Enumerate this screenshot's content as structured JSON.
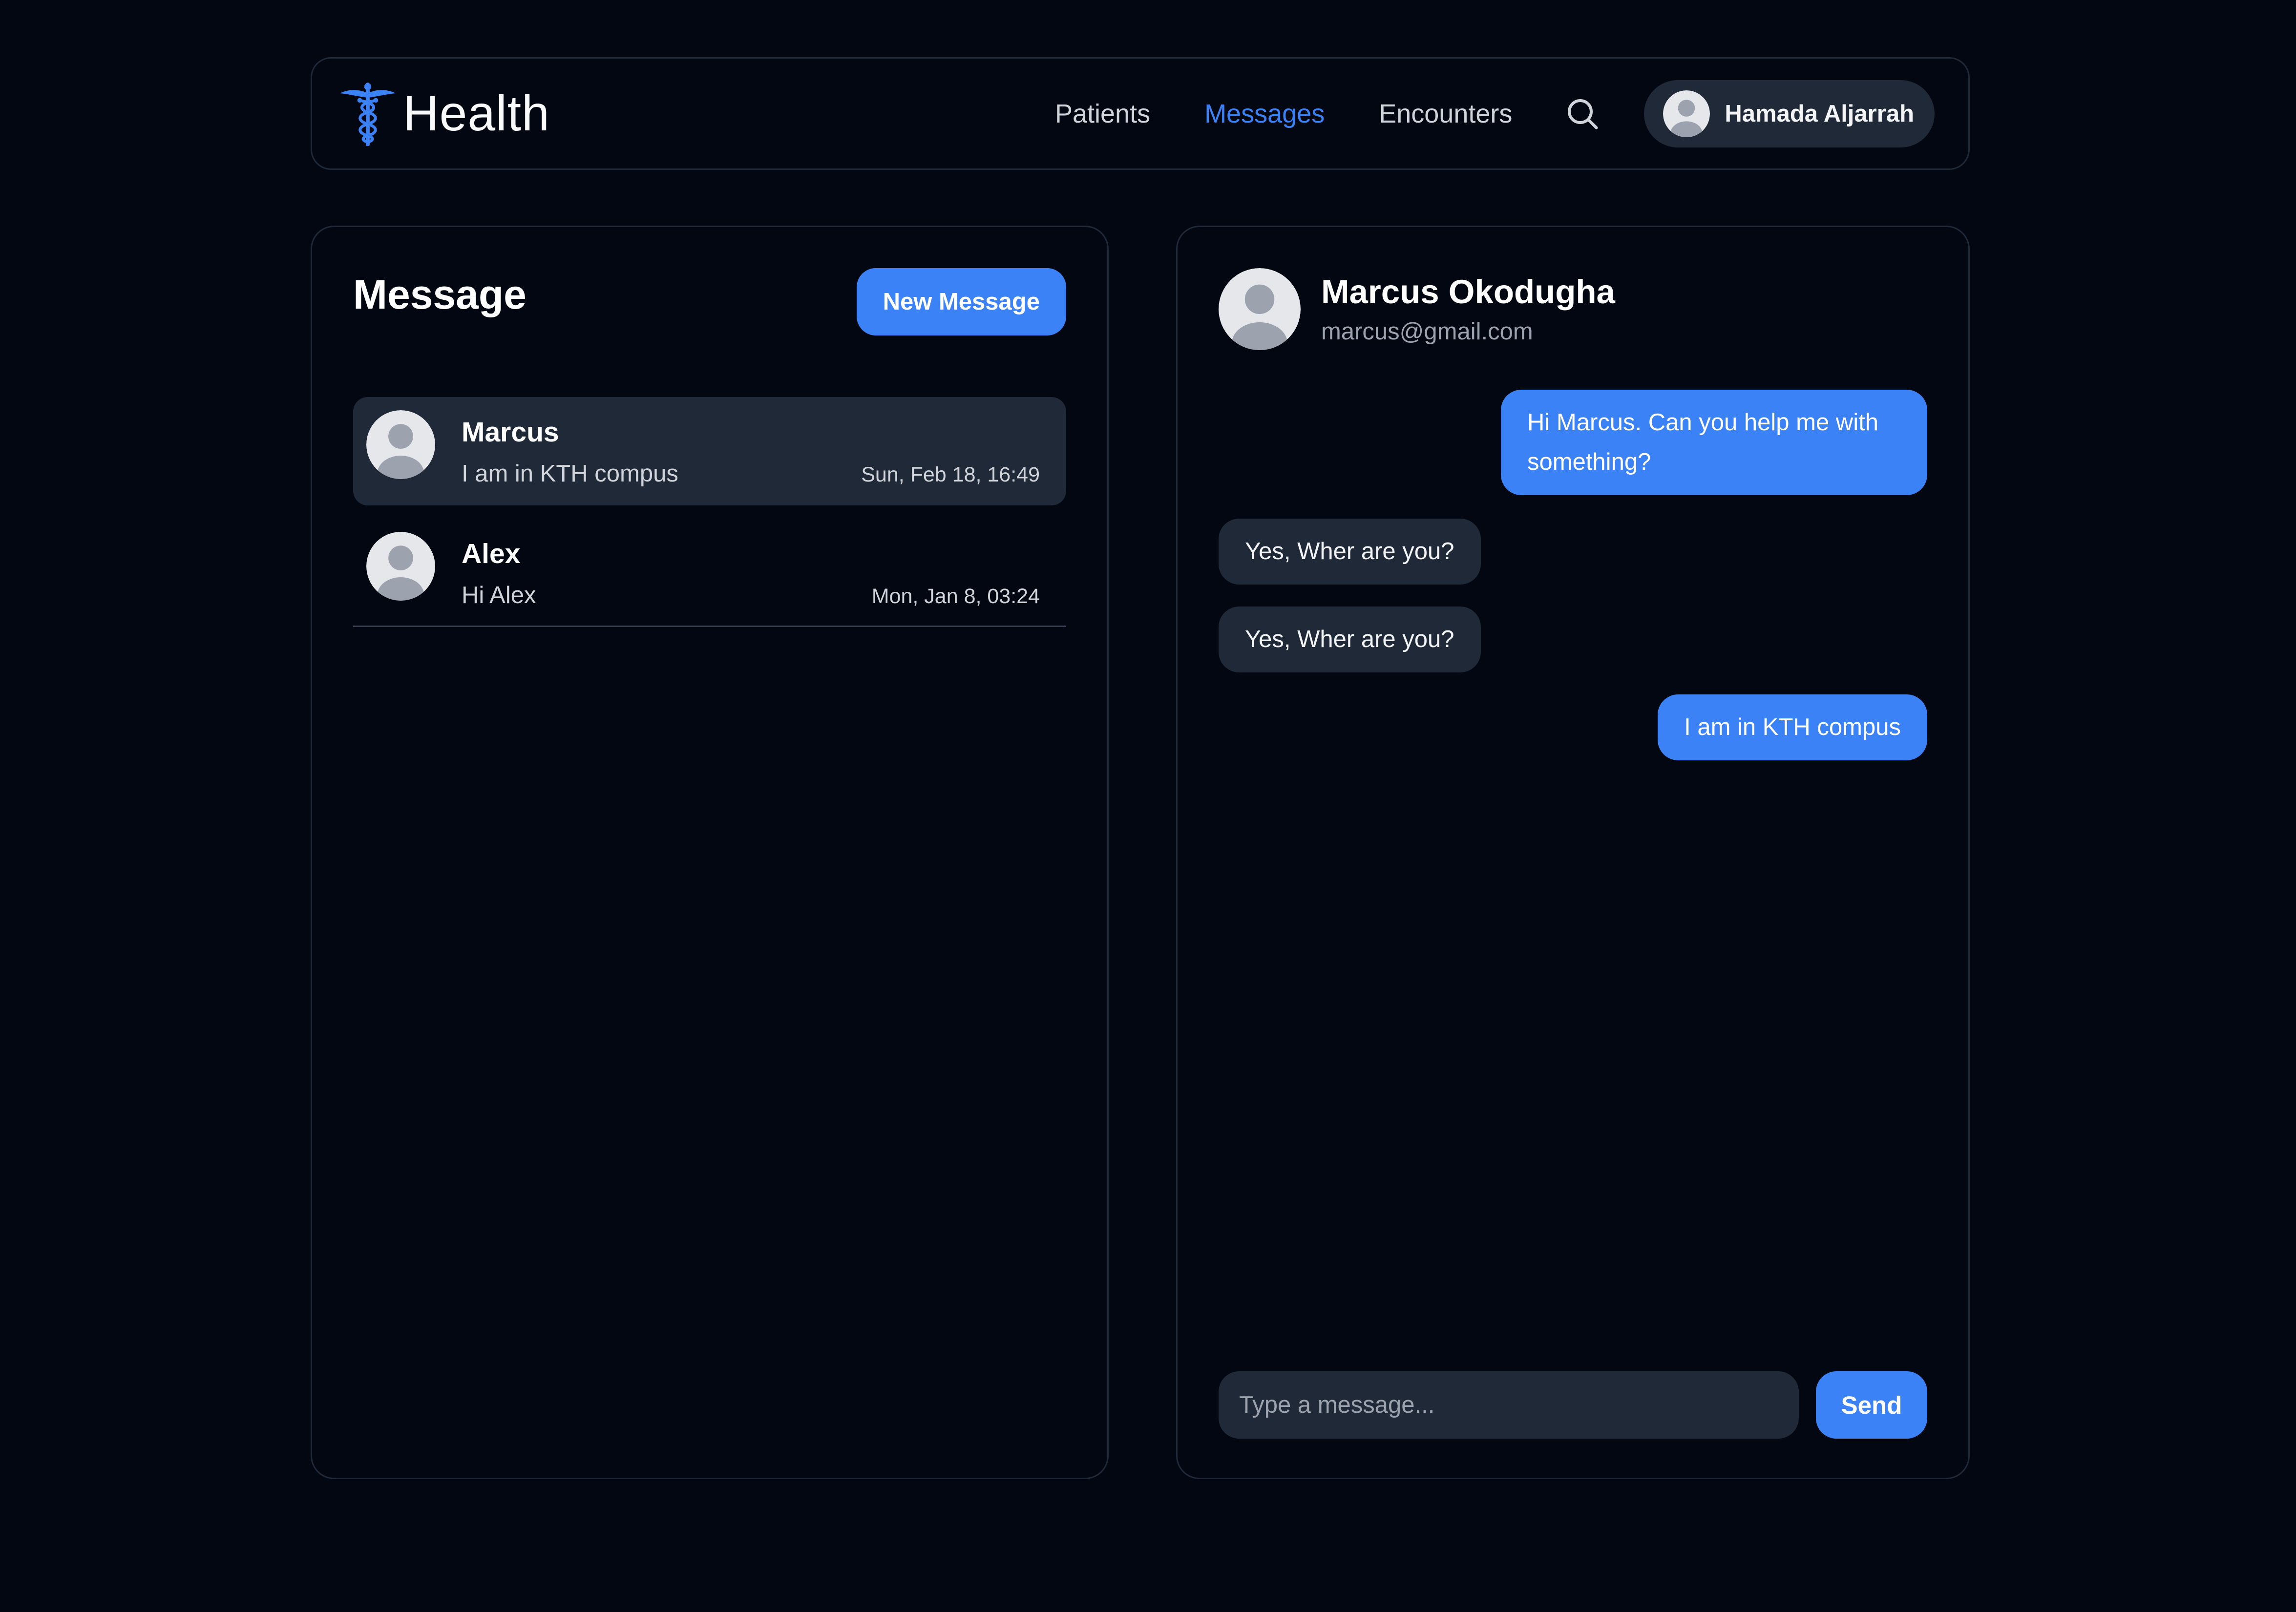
{
  "header": {
    "brand": "Health",
    "nav": [
      {
        "label": "Patients",
        "active": false
      },
      {
        "label": "Messages",
        "active": true
      },
      {
        "label": "Encounters",
        "active": false
      }
    ],
    "user_name": "Hamada Aljarrah",
    "icons": {
      "logo": "caduceus-icon",
      "search": "search-icon",
      "avatar": "user-avatar-icon"
    }
  },
  "list": {
    "title": "Message",
    "new_button": "New Message",
    "conversations": [
      {
        "name": "Marcus",
        "preview": "I am in KTH compus",
        "time": "Sun, Feb 18, 16:49",
        "selected": true
      },
      {
        "name": "Alex",
        "preview": "Hi Alex",
        "time": "Mon, Jan 8, 03:24",
        "selected": false
      }
    ]
  },
  "chat": {
    "contact_name": "Marcus Okodugha",
    "contact_email": "marcus@gmail.com",
    "messages": [
      {
        "text": "Hi Marcus. Can you help me with something?",
        "direction": "out"
      },
      {
        "text": "Yes, Wher are you?",
        "direction": "in"
      },
      {
        "text": "Yes, Wher are you?",
        "direction": "in"
      },
      {
        "text": "I am in KTH compus",
        "direction": "out"
      }
    ],
    "composer_placeholder": "Type a message...",
    "send_label": "Send"
  },
  "colors": {
    "background": "#030712",
    "accent": "#3b82f6",
    "surface": "#1f2937",
    "border": "#1f2937",
    "muted_text": "#9ca3af"
  }
}
